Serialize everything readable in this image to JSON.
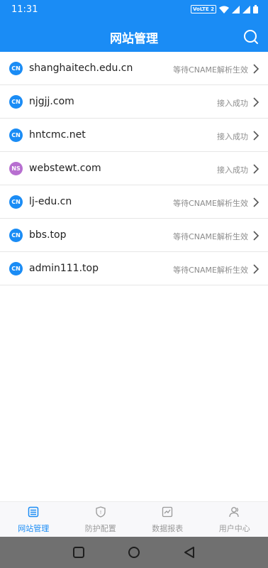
{
  "status_bar": {
    "time": "11:31",
    "network_badge": "VoLTE 2"
  },
  "header": {
    "title": "网站管理",
    "search_icon": "search-icon"
  },
  "sites": [
    {
      "badge": "CN",
      "badge_color": "#1a8cf5",
      "domain": "shanghaitech.edu.cn",
      "status": "等待CNAME解析生效"
    },
    {
      "badge": "CN",
      "badge_color": "#1a8cf5",
      "domain": "njgjj.com",
      "status": "接入成功"
    },
    {
      "badge": "CN",
      "badge_color": "#1a8cf5",
      "domain": "hntcmc.net",
      "status": "接入成功"
    },
    {
      "badge": "NS",
      "badge_color": "#b76fd0",
      "domain": "webstewt.com",
      "status": "接入成功"
    },
    {
      "badge": "CN",
      "badge_color": "#1a8cf5",
      "domain": "lj-edu.cn",
      "status": "等待CNAME解析生效"
    },
    {
      "badge": "CN",
      "badge_color": "#1a8cf5",
      "domain": "bbs.top",
      "status": "等待CNAME解析生效"
    },
    {
      "badge": "CN",
      "badge_color": "#1a8cf5",
      "domain": "admin111.top",
      "status": "等待CNAME解析生效"
    }
  ],
  "tabs": [
    {
      "label": "网站管理",
      "icon": "site-list-icon",
      "active": true
    },
    {
      "label": "防护配置",
      "icon": "shield-icon",
      "active": false
    },
    {
      "label": "数据报表",
      "icon": "chart-icon",
      "active": false
    },
    {
      "label": "用户中心",
      "icon": "user-icon",
      "active": false
    }
  ],
  "colors": {
    "accent": "#1a8cf5",
    "ns_badge": "#b76fd0",
    "inactive_tab": "#9a9a9a"
  }
}
